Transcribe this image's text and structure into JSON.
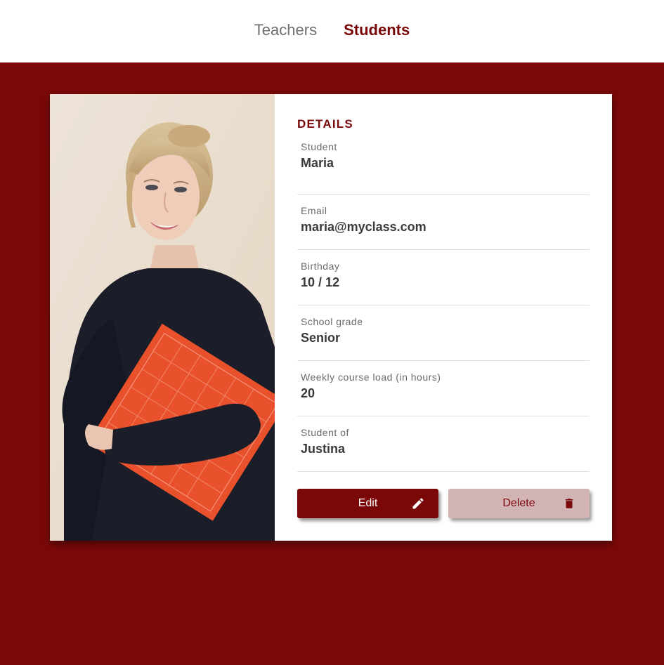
{
  "nav": {
    "teachers_label": "Teachers",
    "students_label": "Students",
    "active": "Students"
  },
  "details": {
    "heading": "DETAILS",
    "fields": [
      {
        "label": "Student",
        "value": "Maria"
      },
      {
        "label": "Email",
        "value": "maria@myclass.com"
      },
      {
        "label": "Birthday",
        "value": "10 / 12"
      },
      {
        "label": "School grade",
        "value": "Senior"
      },
      {
        "label": "Weekly course load (in hours)",
        "value": "20"
      },
      {
        "label": "Student of",
        "value": "Justina"
      }
    ]
  },
  "actions": {
    "edit_label": "Edit",
    "edit_icon": "pencil-icon",
    "delete_label": "Delete",
    "delete_icon": "trash-icon"
  },
  "colors": {
    "brand": "#7a0809",
    "delete_bg": "#d2b4b5",
    "background": "#7a0809"
  }
}
